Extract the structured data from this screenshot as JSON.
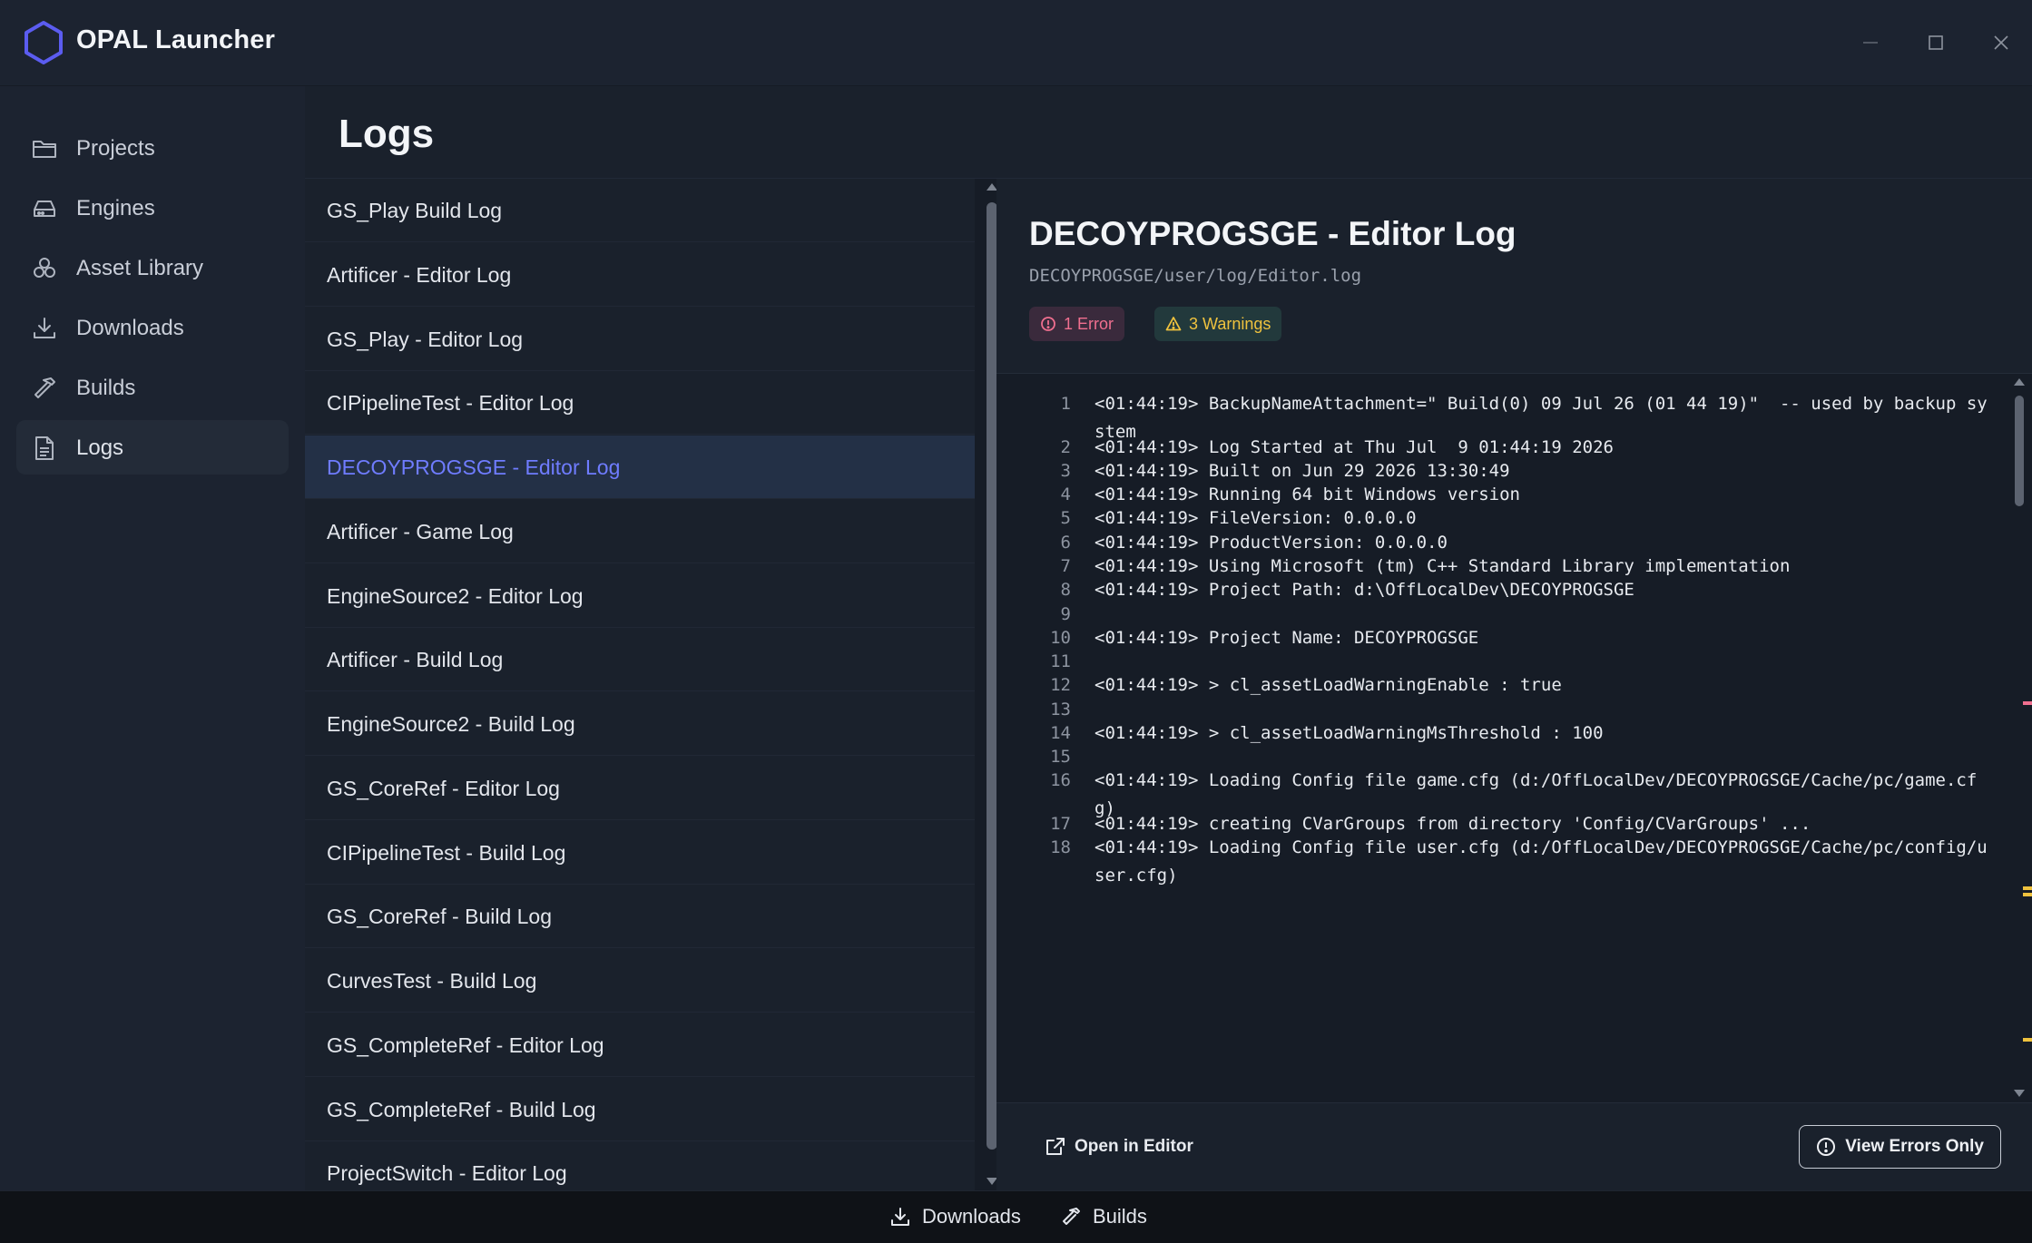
{
  "app": {
    "title": "OPAL Launcher",
    "accent": "#6f7cff"
  },
  "window_controls": {
    "minimize_icon": "minimize-icon",
    "maximize_icon": "maximize-icon",
    "close_icon": "close-icon"
  },
  "sidebar": {
    "items": [
      {
        "label": "Projects",
        "icon": "folder-icon",
        "active": false
      },
      {
        "label": "Engines",
        "icon": "engine-icon",
        "active": false
      },
      {
        "label": "Asset Library",
        "icon": "assets-icon",
        "active": false
      },
      {
        "label": "Downloads",
        "icon": "download-icon",
        "active": false
      },
      {
        "label": "Builds",
        "icon": "hammer-icon",
        "active": false
      },
      {
        "label": "Logs",
        "icon": "document-icon",
        "active": true
      }
    ],
    "footer_icons": [
      "gear-icon",
      "hammer-icon",
      "download-icon",
      "book-icon",
      "collapse-sidebar-icon"
    ]
  },
  "page": {
    "title": "Logs"
  },
  "log_list": {
    "items": [
      "GS_Play Build Log",
      "Artificer - Editor Log",
      "GS_Play - Editor Log",
      "CIPipelineTest - Editor Log",
      "DECOYPROGSGE - Editor Log",
      "Artificer - Game Log",
      "EngineSource2 - Editor Log",
      "Artificer - Build Log",
      "EngineSource2 - Build Log",
      "GS_CoreRef - Editor Log",
      "CIPipelineTest - Build Log",
      "GS_CoreRef - Build Log",
      "CurvesTest - Build Log",
      "GS_CompleteRef - Editor Log",
      "GS_CompleteRef - Build Log",
      "ProjectSwitch - Editor Log"
    ],
    "selected_index": 4
  },
  "detail": {
    "title": "DECOYPROGSGE - Editor Log",
    "path": "DECOYPROGSGE/user/log/Editor.log",
    "error_badge": "1 Error",
    "warning_badge": "3 Warnings",
    "error_color": "#f06f8f",
    "warning_color": "#efc23e",
    "lines": [
      {
        "n": "1",
        "text": "<01:44:19> BackupNameAttachment=\" Build(0) 09 Jul 26 (01 44 19)\"  -- used by backup system"
      },
      {
        "n": "2",
        "text": "<01:44:19> Log Started at Thu Jul  9 01:44:19 2026"
      },
      {
        "n": "3",
        "text": "<01:44:19> Built on Jun 29 2026 13:30:49"
      },
      {
        "n": "4",
        "text": "<01:44:19> Running 64 bit Windows version"
      },
      {
        "n": "5",
        "text": "<01:44:19> FileVersion: 0.0.0.0"
      },
      {
        "n": "6",
        "text": "<01:44:19> ProductVersion: 0.0.0.0"
      },
      {
        "n": "7",
        "text": "<01:44:19> Using Microsoft (tm) C++ Standard Library implementation"
      },
      {
        "n": "8",
        "text": "<01:44:19> Project Path: d:\\OffLocalDev\\DECOYPROGSGE"
      },
      {
        "n": "9",
        "text": ""
      },
      {
        "n": "10",
        "text": "<01:44:19> Project Name: DECOYPROGSGE"
      },
      {
        "n": "11",
        "text": ""
      },
      {
        "n": "12",
        "text": "<01:44:19> > cl_assetLoadWarningEnable : true"
      },
      {
        "n": "13",
        "text": ""
      },
      {
        "n": "14",
        "text": "<01:44:19> > cl_assetLoadWarningMsThreshold : 100"
      },
      {
        "n": "15",
        "text": ""
      },
      {
        "n": "16",
        "text": "<01:44:19> Loading Config file game.cfg (d:/OffLocalDev/DECOYPROGSGE/Cache/pc/game.cfg)"
      },
      {
        "n": "17",
        "text": "<01:44:19> creating CVarGroups from directory 'Config/CVarGroups' ..."
      },
      {
        "n": "18",
        "text": "<01:44:19> Loading Config file user.cfg (d:/OffLocalDev/DECOYPROGSGE/Cache/pc/config/user.cfg)"
      }
    ],
    "open_in_editor": "Open in Editor",
    "view_errors_only": "View Errors Only"
  },
  "statusbar": {
    "downloads": "Downloads",
    "builds": "Builds"
  }
}
